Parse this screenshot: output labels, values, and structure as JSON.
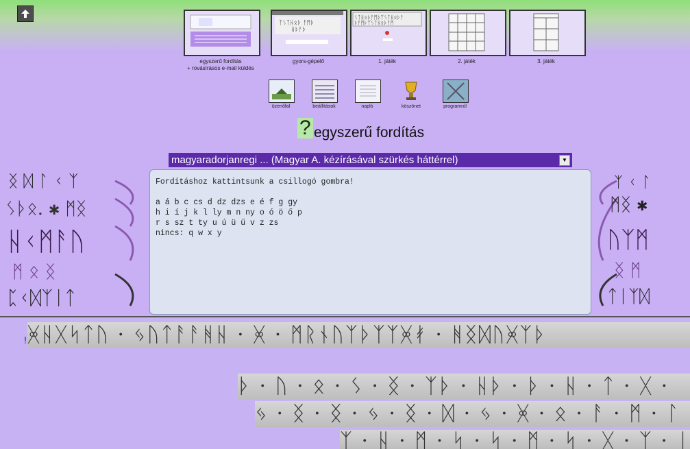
{
  "nav": {
    "thumbnails": [
      {
        "label": "egyszerű fordítás\n+ rovásírásos e-mail küldés"
      },
      {
        "label": "gyors-gépelő"
      },
      {
        "label": "1. játék"
      },
      {
        "label": "2. játék"
      },
      {
        "label": "3. játék"
      }
    ],
    "small_items": [
      {
        "label": "üzenőfal"
      },
      {
        "label": "beállítások"
      },
      {
        "label": "napló"
      },
      {
        "label": "köszönet"
      },
      {
        "label": "programról"
      }
    ]
  },
  "page": {
    "help_symbol": "?",
    "title": "egyszerű fordítás"
  },
  "font_select": {
    "value": "magyaradorjanregi ... (Magyar A. kézírásával szürkés háttérrel)"
  },
  "textarea": {
    "value": "Fordításhoz kattintsunk a csillogó gombra!\n\na á b c cs d dz dzs e é f g gy\nh i í j k l ly m n ny o ó ö ő p\nr s sz t ty u ú ü ű v z zs\nnincs: q w x y"
  },
  "output": {
    "exclamation": "!",
    "rune_line1": "ᚸᚺᚷᛋᛏᚢ · ᛃᚢᛏᚨᚨᚻᚺ · ᚸ · ᛗᚱᚾᚢᛉᚦᛉᛉᚸᚯ · ᚻᛝᛞᚢᚸᛉᚦ",
    "rune_line2": "ᚦ · ᚢ · ᛟ · ᛊ · ᛝ · ᛉᚦ · ᚺᚦ · ᚦ · ᚺ · ᛏ · ᚷ ·",
    "rune_line3": "ᛃ · ᛝ · ᛝ · ᛃ · ᛝ · ᛞ · ᛃ · ᚸ · ᛟ · ᚨ · ᛗ · ᛚ · ᚦ ·",
    "rune_line4": "ᛉ · ᚺ · ᛗ · ᛋ · ᛋ · ᛗ · ᛋ · ᚷ · ᛉ · ᛁ"
  },
  "colors": {
    "page_bg": "#c9b0f5",
    "select_bg": "#5a2aa8",
    "top_green": "#8fe07a"
  }
}
